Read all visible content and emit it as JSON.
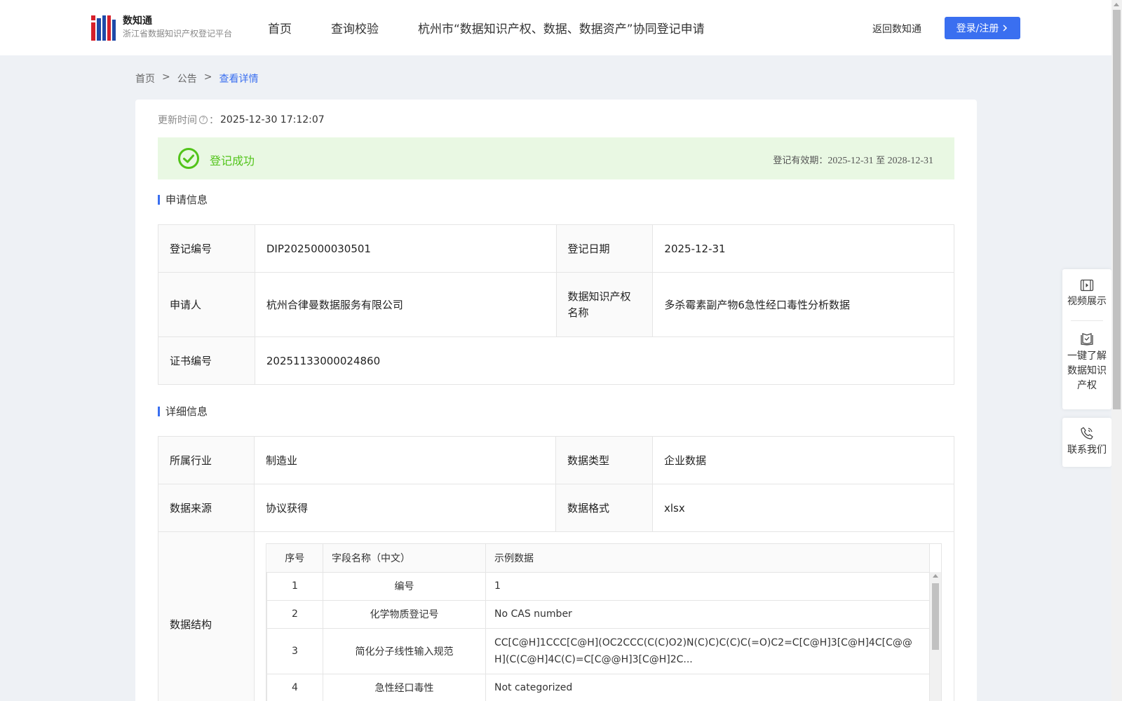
{
  "header": {
    "logo_title": "数知通",
    "logo_subtitle": "浙江省数据知识产权登记平台",
    "nav": [
      "首页",
      "查询校验",
      "杭州市“数据知识产权、数据、数据资产”协同登记申请"
    ],
    "back_link": "返回数知通",
    "login_label": "登录/注册"
  },
  "breadcrumb": {
    "home": "首页",
    "notice": "公告",
    "current": "查看详情",
    "separator": ">"
  },
  "update": {
    "label": "更新时间",
    "colon": "：",
    "value": "2025-12-30 17:12:07"
  },
  "status": {
    "text": "登记成功",
    "valid_label": "登记有效期：",
    "valid_from": "2025-12-31",
    "valid_to_word": "至",
    "valid_to": "2028-12-31",
    "color": "#52c41a"
  },
  "application_section": {
    "title": "申请信息",
    "reg_no_label": "登记编号",
    "reg_no": "DIP2025000030501",
    "reg_date_label": "登记日期",
    "reg_date": "2025-12-31",
    "applicant_label": "申请人",
    "applicant": "杭州合律曼数据服务有限公司",
    "ip_name_label": "数据知识产权名称",
    "ip_name": "多杀霉素副产物6急性经口毒性分析数据",
    "cert_no_label": "证书编号",
    "cert_no": "20251133000024860"
  },
  "detail_section": {
    "title": "详细信息",
    "industry_label": "所属行业",
    "industry": "制造业",
    "data_type_label": "数据类型",
    "data_type": "企业数据",
    "source_label": "数据来源",
    "source": "协议获得",
    "format_label": "数据格式",
    "format": "xlsx",
    "structure_label": "数据结构",
    "structure_headers": [
      "序号",
      "字段名称（中文）",
      "示例数据"
    ],
    "structure_rows": [
      [
        "1",
        "编号",
        "1"
      ],
      [
        "2",
        "化学物质登记号",
        "No CAS number"
      ],
      [
        "3",
        "简化分子线性输入规范",
        "CC[C@H]1CCC[C@H](OC2CCC(C(C)O2)N(C)C)C(C)C(=O)C2=C[C@H]3[C@H]4C[C@@H](C(C@H]4C(C)=C[C@@H]3[C@H]2C..."
      ],
      [
        "4",
        "急性经口毒性",
        "Not categorized"
      ]
    ]
  },
  "float_panel": {
    "video": "视频展示",
    "learn_line1": "一键了解",
    "learn_line2": "数据知识",
    "learn_line3": "产权",
    "contact": "联系我们"
  },
  "colors": {
    "accent": "#3a6ff0",
    "success_bg": "#e9f8e3"
  }
}
